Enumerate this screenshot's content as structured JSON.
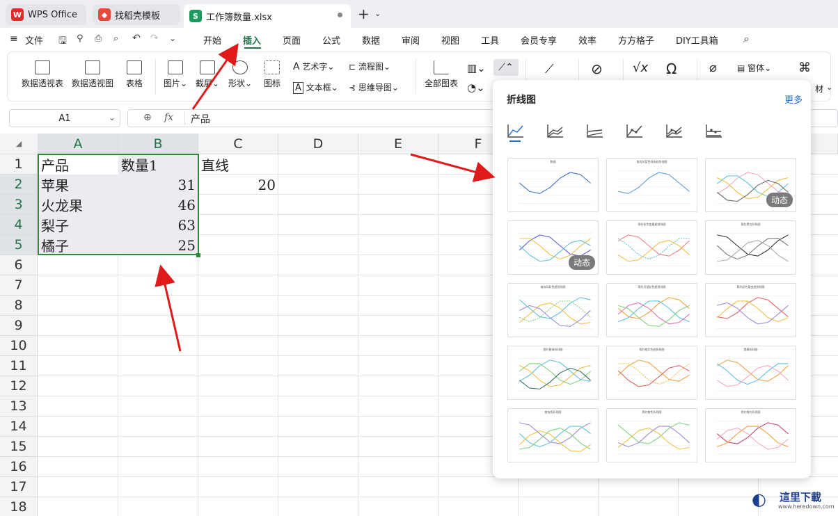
{
  "tabs": [
    {
      "label": "WPS Office"
    },
    {
      "label": "找稻壳模板"
    },
    {
      "label": "工作簿数量.xlsx"
    }
  ],
  "menu": {
    "file": "文件",
    "items": [
      "开始",
      "插入",
      "页面",
      "公式",
      "数据",
      "审阅",
      "视图",
      "工具",
      "会员专享",
      "效率",
      "方方格子",
      "DIY工具箱"
    ]
  },
  "ribbon": {
    "pivot_table": "数据透视表",
    "pivot_chart": "数据透视图",
    "table": "表格",
    "picture": "图片",
    "screenshot": "截屏",
    "shape": "形状",
    "icon": "图标",
    "wordart": "艺术字",
    "textbox": "文本框",
    "flowchart": "流程图",
    "mindmap": "思维导图",
    "all_charts": "全部图表",
    "form": "窗体",
    "tail": "材"
  },
  "formula": {
    "cell_ref": "A1",
    "fx": "fx",
    "content": "产品"
  },
  "columns": [
    "A",
    "B",
    "C",
    "D",
    "E",
    "F"
  ],
  "rows": [
    "1",
    "2",
    "3",
    "4",
    "5",
    "6",
    "7",
    "8",
    "9",
    "10",
    "11",
    "12",
    "13",
    "14",
    "15",
    "16",
    "17",
    "18"
  ],
  "cells": {
    "a1": "产品",
    "b1": "数量1",
    "c1": "直线",
    "a2": "苹果",
    "b2": "31",
    "c2": "20",
    "a3": "火龙果",
    "b3": "46",
    "a4": "梨子",
    "b4": "63",
    "a5": "橘子",
    "b5": "25"
  },
  "popup": {
    "title": "折线图",
    "more": "更多",
    "badge": "动态",
    "thumb_titles": {
      "t0": "数据",
      "t1": "商务风蓝色线条趋势线图",
      "t4": "简约彩色变更趋势线图",
      "t5": "简约黑白折线图",
      "t6": "商务风彩色趋势线图",
      "t7": "简约可爱彩色趋势线图",
      "t8": "简约彩色渐变趋势线图",
      "t9": "简约黄绿折线图",
      "t10": "简约橙红色趋势线图",
      "t11": "素雅折线图",
      "t12": "商务简折线图",
      "t13": "简约紫色折线图",
      "t14": "简约简约折线图"
    }
  },
  "colors": {
    "accent_green": "#217346",
    "selection_border": "#2e8b3a",
    "arrow": "#e01a1a",
    "link_blue": "#1f6fd6"
  },
  "watermark": {
    "text": "這里下載",
    "url": "www.heredown.com"
  }
}
